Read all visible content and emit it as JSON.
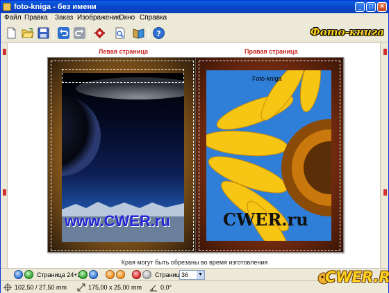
{
  "window": {
    "title": "foto-kniga - без имени",
    "controls": {
      "minimize": "_",
      "maximize": "□",
      "close": "×"
    }
  },
  "menu": {
    "items": [
      "Файл",
      "Правка",
      "Заказ",
      "Изображение",
      "Окно",
      "Справка"
    ]
  },
  "toolbar": {
    "brand": "Фото-книга",
    "buttons": [
      "new-doc-icon",
      "open-folder-icon",
      "save-icon",
      "undo-icon",
      "redo-icon",
      "settings-icon",
      "preview-icon",
      "book-icon",
      "help-icon"
    ]
  },
  "pages": {
    "left_label": "Левая страница",
    "right_label": "Правая страница",
    "left_watermark": "www.CWER.ru",
    "right_watermark": "CWER.ru",
    "right_caption": "Foto-kniga"
  },
  "notice": "Края могут быть обрезаны во время изготовления",
  "navigation": {
    "spread_label": "Страница 24+25",
    "pages_label": "Страницы",
    "pages_value": "36"
  },
  "status": {
    "position": "102,50 / 27,50 mm",
    "size": "175,00 x 25,00 mm",
    "angle": "0,0°"
  },
  "logo_text": "CWER.RU",
  "colors": {
    "accent": "#0a5fe0",
    "label_red": "#c62020",
    "brand_yellow": "#ffd21f"
  }
}
